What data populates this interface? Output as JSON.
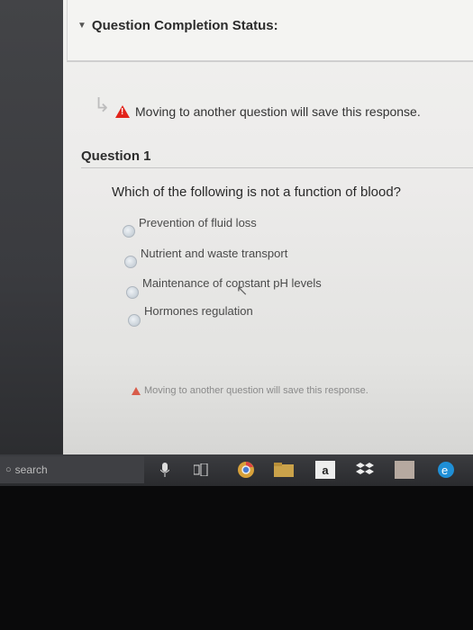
{
  "status": {
    "title": "Question Completion Status:"
  },
  "notice": {
    "text": "Moving to another question will save this response."
  },
  "question": {
    "title": "Question 1",
    "prompt": "Which of the following is not a function of blood?",
    "options": [
      "Prevention of fluid loss",
      "Nutrient and waste transport",
      "Maintenance of constant pH levels",
      "Hormones regulation"
    ]
  },
  "footer_notice": {
    "text": "Moving to another question will save this response."
  },
  "taskbar": {
    "search_placeholder": "search",
    "icons": [
      "microphone-icon",
      "task-view-icon",
      "chrome-icon",
      "file-explorer-icon",
      "amazon-icon",
      "dropbox-icon",
      "app-icon",
      "edge-icon"
    ],
    "amazon_letter": "a"
  },
  "colors": {
    "warning": "#e2231a",
    "panel": "#f1f1ef",
    "taskbar": "#2a2b2e"
  }
}
